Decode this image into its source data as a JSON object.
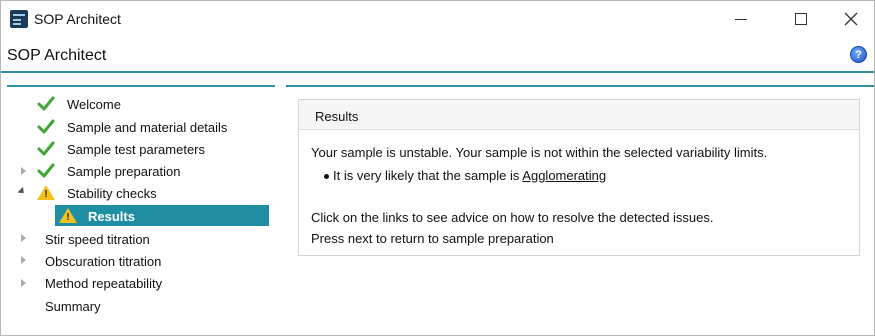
{
  "window": {
    "title": "SOP Architect",
    "icon": "app-logo-icon",
    "controls": [
      "minimize-icon",
      "maximize-icon",
      "close-icon"
    ]
  },
  "header": {
    "title": "SOP Architect",
    "help_icon": "help-icon",
    "help_glyph": "?"
  },
  "nav": {
    "items": [
      {
        "label": "Welcome",
        "status": "check-icon",
        "expander": "none"
      },
      {
        "label": "Sample and material details",
        "status": "check-icon",
        "expander": "none"
      },
      {
        "label": "Sample test parameters",
        "status": "check-icon",
        "expander": "none"
      },
      {
        "label": "Sample preparation",
        "status": "check-icon",
        "expander": "collapsed"
      },
      {
        "label": "Stability checks",
        "status": "warning-icon",
        "expander": "expanded"
      },
      {
        "label": "Results",
        "status": "warning-icon",
        "expander": "none",
        "selected": true,
        "indent": 2
      },
      {
        "label": "Stir speed titration",
        "status": "none",
        "expander": "collapsed"
      },
      {
        "label": "Obscuration titration",
        "status": "none",
        "expander": "collapsed"
      },
      {
        "label": "Method repeatability",
        "status": "none",
        "expander": "collapsed"
      },
      {
        "label": "Summary",
        "status": "none",
        "expander": "none"
      }
    ]
  },
  "results": {
    "title": "Results",
    "summary": "Your sample is unstable. Your sample is not within the selected variability limits.",
    "bullet_prefix": "It is very likely that the sample is ",
    "bullet_link": "Agglomerating",
    "advice": "Click on the links to see advice on how to resolve the detected issues.",
    "next_hint": "Press next to return to sample preparation"
  },
  "colors": {
    "accent": "#1f8ea3",
    "check": "#3fa535",
    "warning": "#f2c21b"
  }
}
